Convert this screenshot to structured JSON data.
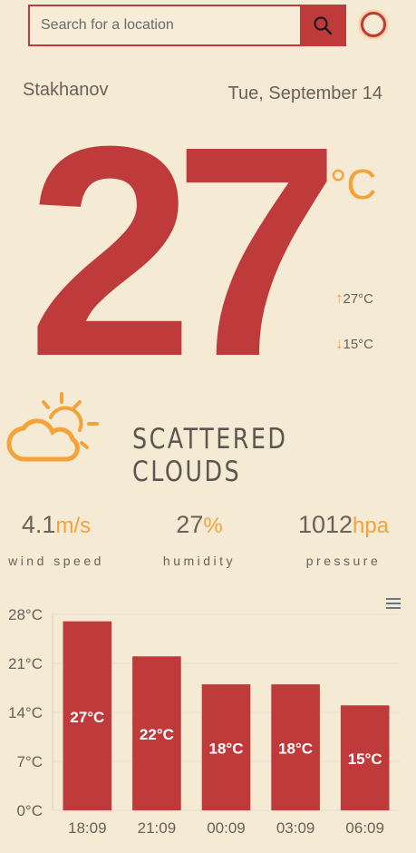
{
  "search": {
    "placeholder": "Search for a location"
  },
  "location": {
    "city": "Stakhanov",
    "date": "Tue, September 14"
  },
  "current": {
    "temp": "27",
    "unit": "°C",
    "max": "27°C",
    "min": "15°C",
    "condition": "SCATTERED CLOUDS"
  },
  "stats": {
    "wind": {
      "value": "4.1",
      "unit": "m/s",
      "label": "wind speed"
    },
    "humidity": {
      "value": "27",
      "unit": "%",
      "label": "humidity"
    },
    "pressure": {
      "value": "1012",
      "unit": "hpa",
      "label": "pressure"
    }
  },
  "icons": {
    "search": "search-icon",
    "theme": "theme-toggle-icon",
    "weather": "scattered-clouds-icon",
    "menu": "hamburger-menu-icon"
  },
  "colors": {
    "accent": "#bf3b3b",
    "highlight": "#f4a23a",
    "background": "#f5ead3"
  },
  "chart_data": {
    "type": "bar",
    "categories": [
      "18:09",
      "21:09",
      "00:09",
      "03:09",
      "06:09"
    ],
    "values": [
      27,
      22,
      18,
      18,
      15
    ],
    "data_labels": [
      "27°C",
      "22°C",
      "18°C",
      "18°C",
      "15°C"
    ],
    "yticks": [
      "0°C",
      "7°C",
      "14°C",
      "21°C",
      "28°C"
    ],
    "ytick_values": [
      0,
      7,
      14,
      21,
      28
    ],
    "ylim": [
      0,
      28
    ],
    "grid": true,
    "legend": false,
    "bar_color": "#bf3b3b"
  }
}
